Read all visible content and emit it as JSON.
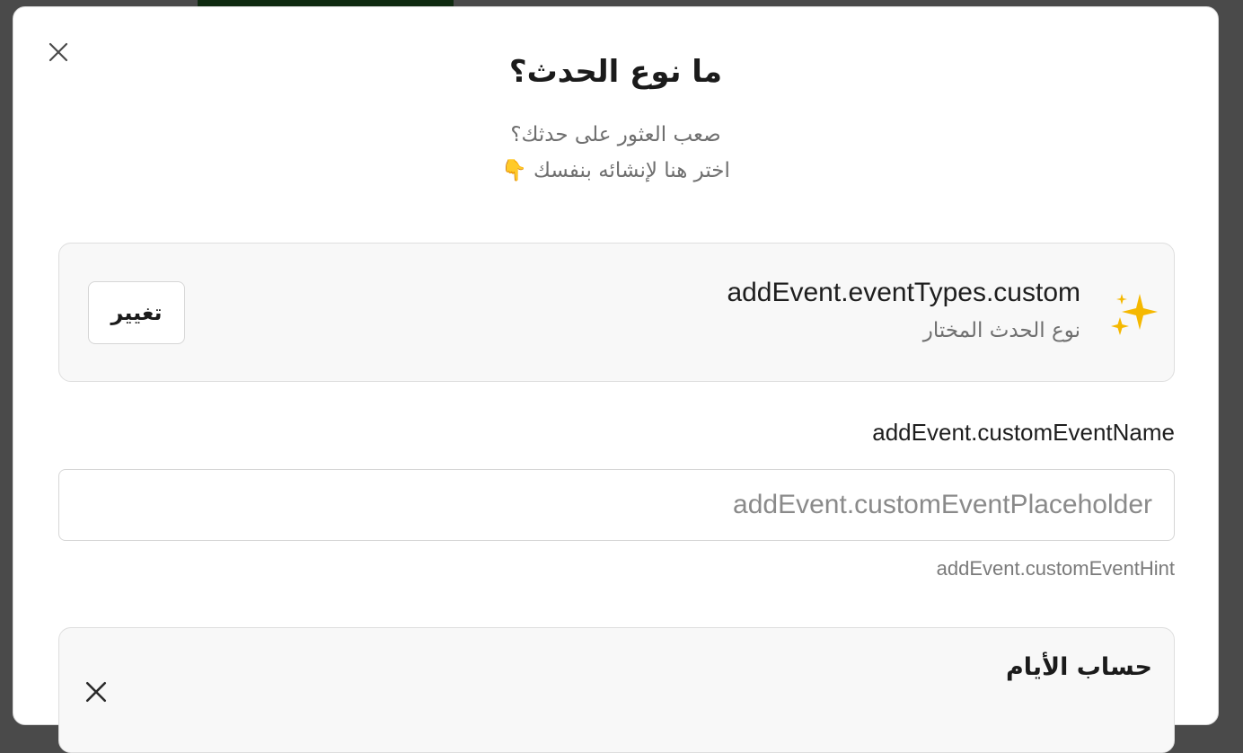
{
  "modal": {
    "title": "ما نوع الحدث؟",
    "subtitle_line1": "صعب العثور على حدثك؟",
    "subtitle_line2": "اختر هنا لإنشائه بنفسك 👇",
    "close_icon": "close-icon"
  },
  "selected_type": {
    "icon": "sparkles-icon",
    "name": "addEvent.eventTypes.custom",
    "caption": "نوع الحدث المختار",
    "change_label": "تغيير"
  },
  "custom_event": {
    "label": "addEvent.customEventName",
    "placeholder": "addEvent.customEventPlaceholder",
    "value": "",
    "hint": "addEvent.customEventHint"
  },
  "day_counter": {
    "title": "حساب الأيام",
    "close_icon": "close-icon"
  },
  "colors": {
    "accent_sparkle": "#f5b800",
    "text_primary": "#1b1b1b",
    "text_muted": "#6f6f6f",
    "card_bg": "#f8f8f8",
    "border": "#dedede"
  }
}
